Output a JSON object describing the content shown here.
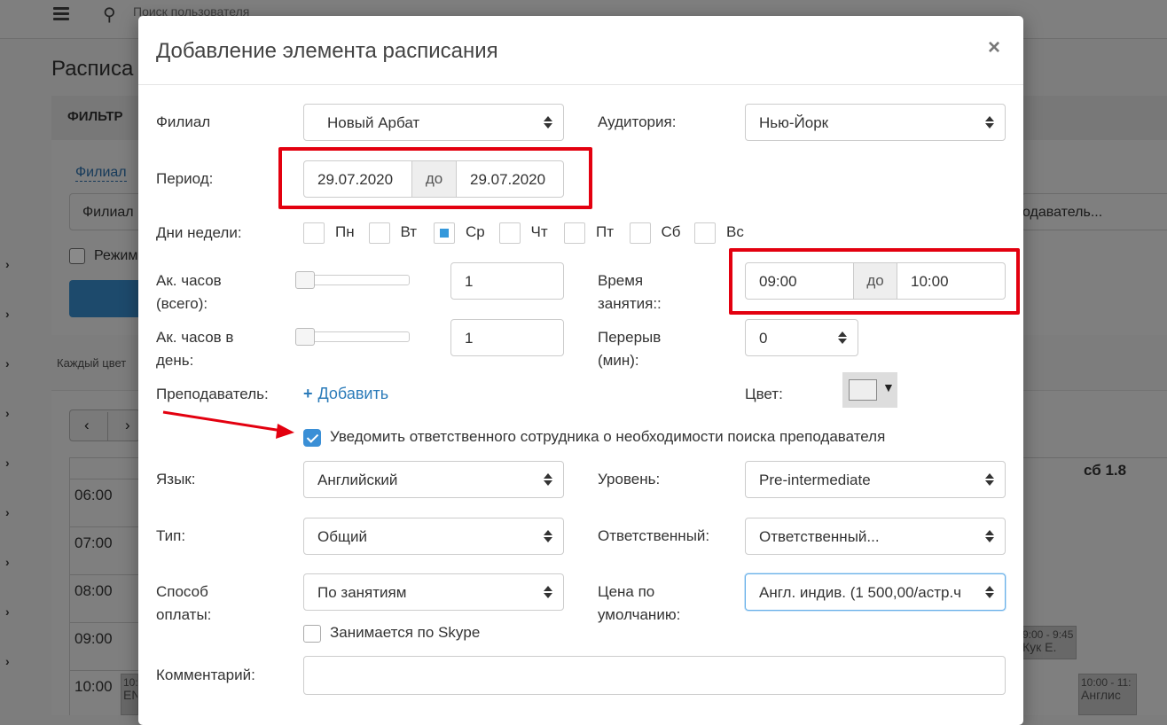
{
  "background": {
    "search_placeholder": "Поиск пользователя",
    "page_title": "Расписа",
    "filter_label": "ФИЛЬТР",
    "filial_link": "Филиал",
    "filial_select": "Филиал",
    "teacher_select": "одаватель...",
    "regime_label": "Режим",
    "hint_text": "Каждый цвет",
    "prev_icon": "‹",
    "next_icon": "›",
    "day_header": "сб 1.8",
    "times": [
      "06:00",
      "07:00",
      "08:00",
      "09:00",
      "10:00"
    ],
    "events": [
      {
        "time": "9:00 - 9:45",
        "name": "Кук Е."
      },
      {
        "time": "10:00 - 11:",
        "name": "Англис"
      },
      {
        "time": "10:",
        "name": "EN"
      }
    ]
  },
  "modal": {
    "title": "Добавление элемента расписания",
    "close_icon": "×",
    "labels": {
      "filial": "Филиал",
      "auditorium": "Аудитория:",
      "period": "Период:",
      "weekdays": "Дни недели:",
      "hours_total_1": "Ак. часов",
      "hours_total_2": "(всего):",
      "hours_day_1": "Ак. часов в",
      "hours_day_2": "день:",
      "lesson_time_1": "Время",
      "lesson_time_2": "занятия::",
      "break_1": "Перерыв",
      "break_2": "(мин):",
      "teacher": "Преподаватель:",
      "color": "Цвет:",
      "language": "Язык:",
      "level": "Уровень:",
      "type": "Тип:",
      "responsible": "Ответственный:",
      "payment_1": "Способ",
      "payment_2": "оплаты:",
      "price_1": "Цена по",
      "price_2": "умолчанию:",
      "comment": "Комментарий:"
    },
    "values": {
      "filial": "Новый Арбат",
      "auditorium": "Нью-Йорк",
      "period_from": "29.07.2020",
      "period_to": "29.07.2020",
      "to_word": "до",
      "hours_total": "1",
      "hours_day": "1",
      "time_from": "09:00",
      "time_to": "10:00",
      "break": "0",
      "language": "Английский",
      "level": "Pre-intermediate",
      "type": "Общий",
      "responsible": "Ответственный...",
      "payment": "По занятиям",
      "price": "Англ. индив. (1 500,00/астр.ч",
      "comment": ""
    },
    "weekdays": [
      {
        "label": "Пн",
        "checked": false
      },
      {
        "label": "Вт",
        "checked": false
      },
      {
        "label": "Ср",
        "checked": true
      },
      {
        "label": "Чт",
        "checked": false
      },
      {
        "label": "Пт",
        "checked": false
      },
      {
        "label": "Сб",
        "checked": false
      },
      {
        "label": "Вс",
        "checked": false
      }
    ],
    "add_teacher": "Добавить",
    "add_icon": "+",
    "color_dropdown_icon": "▼",
    "notify_label": "Уведомить ответственного сотрудника о необходимости поиска преподавателя",
    "notify_checked": true,
    "skype_label": "Занимается по Skype",
    "skype_checked": false
  },
  "annotation_color": "#e3000f",
  "accent_color": "#3a8fd6"
}
